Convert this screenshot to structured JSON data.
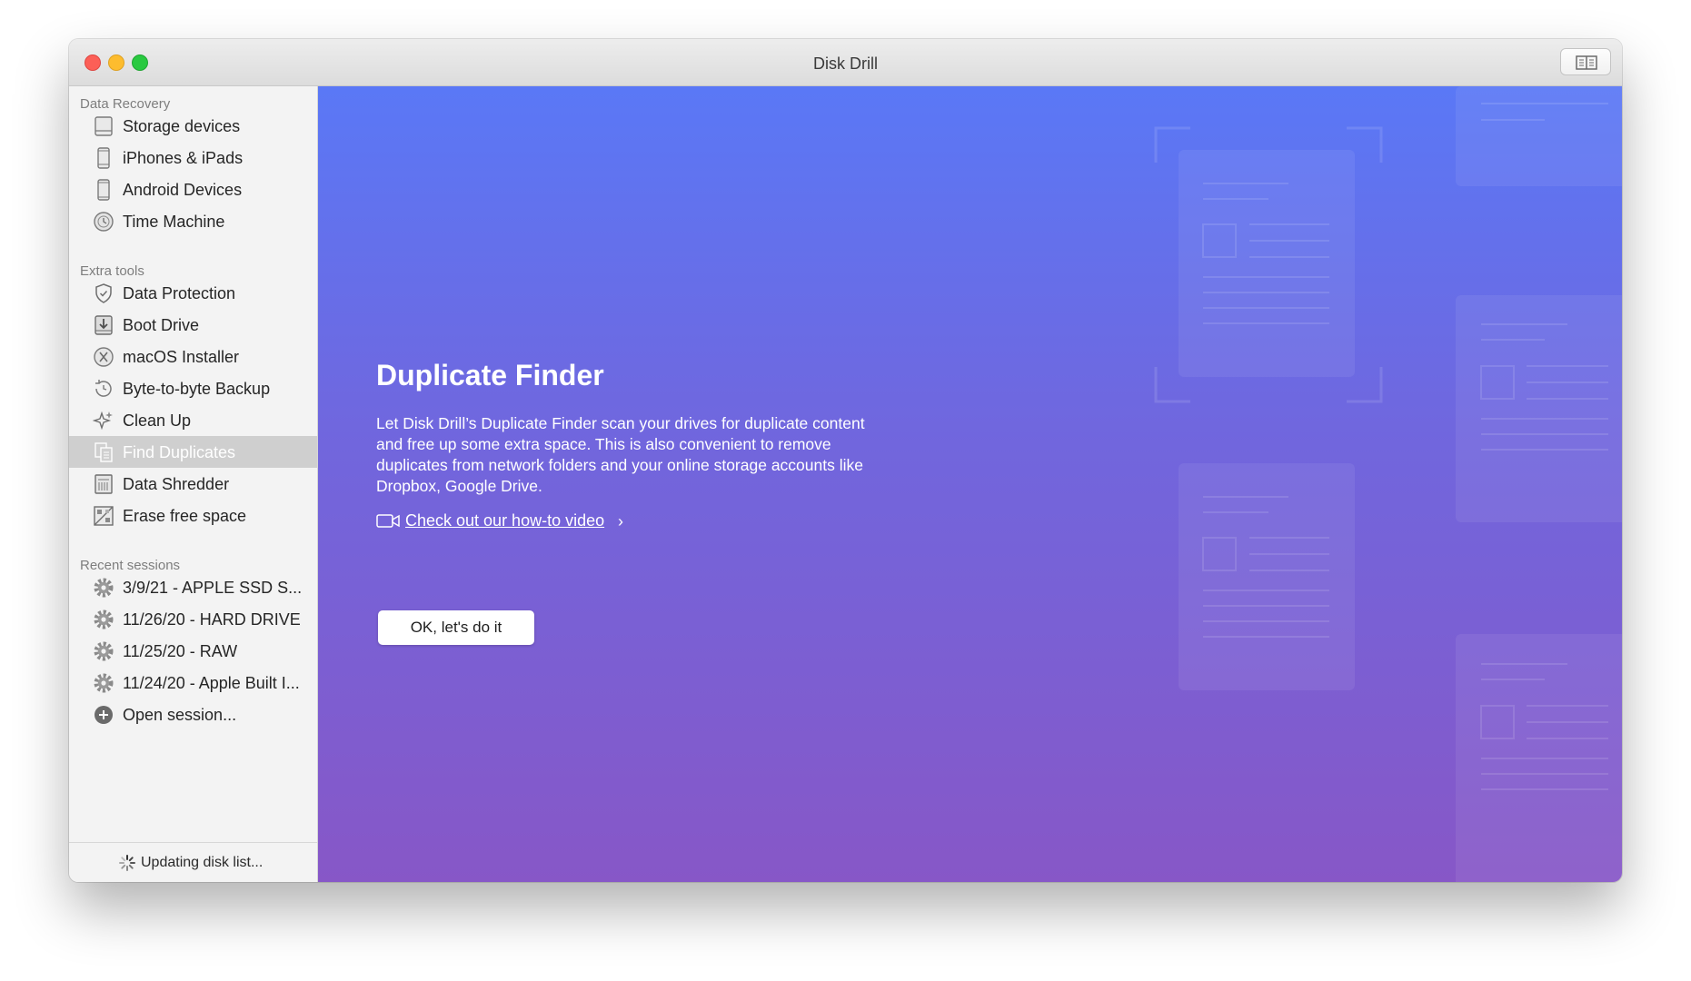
{
  "window": {
    "title": "Disk Drill"
  },
  "sidebar": {
    "sections": [
      {
        "heading": "Data Recovery",
        "items": [
          {
            "label": "Storage devices",
            "icon": "hard-drive-icon"
          },
          {
            "label": "iPhones & iPads",
            "icon": "iphone-icon"
          },
          {
            "label": "Android Devices",
            "icon": "android-phone-icon"
          },
          {
            "label": "Time Machine",
            "icon": "time-machine-icon"
          }
        ]
      },
      {
        "heading": "Extra tools",
        "items": [
          {
            "label": "Data Protection",
            "icon": "shield-icon"
          },
          {
            "label": "Boot Drive",
            "icon": "boot-drive-icon"
          },
          {
            "label": "macOS Installer",
            "icon": "macos-x-icon"
          },
          {
            "label": "Byte-to-byte Backup",
            "icon": "backup-clock-icon"
          },
          {
            "label": "Clean Up",
            "icon": "sparkle-icon"
          },
          {
            "label": "Find Duplicates",
            "icon": "duplicate-files-icon",
            "selected": true
          },
          {
            "label": "Data Shredder",
            "icon": "shredder-icon"
          },
          {
            "label": "Erase free space",
            "icon": "erase-free-space-icon"
          }
        ]
      },
      {
        "heading": "Recent sessions",
        "items": [
          {
            "label": "3/9/21 - APPLE SSD S...",
            "icon": "gear-icon"
          },
          {
            "label": "11/26/20 - HARD DRIVE",
            "icon": "gear-icon"
          },
          {
            "label": "11/25/20 - RAW",
            "icon": "gear-icon"
          },
          {
            "label": "11/24/20 - Apple Built I...",
            "icon": "gear-icon"
          },
          {
            "label": "Open session...",
            "icon": "plus-circle-icon"
          }
        ]
      }
    ],
    "status": "Updating disk list..."
  },
  "main": {
    "title": "Duplicate Finder",
    "description": "Let Disk Drill’s Duplicate Finder scan your drives for duplicate content and free up some extra space. This is also convenient to remove duplicates from network folders and your online storage accounts like Dropbox, Google Drive.",
    "howto_link": "Check out our how-to video",
    "howto_chevron": "›",
    "cta": "OK, let's do it"
  },
  "colors": {
    "gradient_top": "#5a78f6",
    "gradient_bottom": "#8757c7",
    "selected_row": "#cfcfcf"
  }
}
